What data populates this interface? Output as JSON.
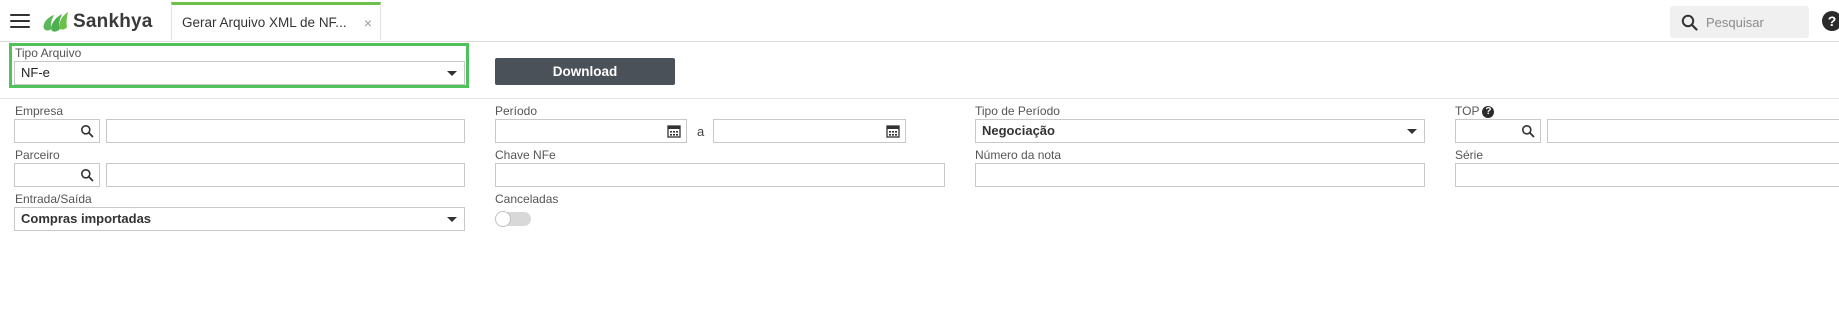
{
  "app": {
    "brand": "Sankhya",
    "tab_title": "Gerar Arquivo XML de NF...",
    "tab_close": "×"
  },
  "search": {
    "placeholder": "Pesquisar"
  },
  "help": {
    "label": "?"
  },
  "form": {
    "tipo_arquivo": {
      "label": "Tipo Arquivo",
      "value": "NF-e"
    },
    "download_label": "Download",
    "empresa": {
      "label": "Empresa"
    },
    "parceiro": {
      "label": "Parceiro"
    },
    "entrada_saida": {
      "label": "Entrada/Saída",
      "value": "Compras importadas"
    },
    "periodo": {
      "label": "Período",
      "separator": "a"
    },
    "chave_nfe": {
      "label": "Chave NFe"
    },
    "canceladas": {
      "label": "Canceladas",
      "checked": false
    },
    "tipo_periodo": {
      "label": "Tipo de Período",
      "value": "Negociação"
    },
    "numero_nota": {
      "label": "Número da nota"
    },
    "top": {
      "label": "TOP",
      "help": "?"
    },
    "serie": {
      "label": "Série"
    }
  },
  "colors": {
    "accent_green": "#4fc35a",
    "tab_green": "#6cc04a",
    "button_dark": "#4a5159"
  },
  "icons": {
    "menu": "hamburger-icon",
    "search": "search-icon",
    "calendar": "calendar-icon",
    "dropdown": "chevron-down-icon"
  }
}
